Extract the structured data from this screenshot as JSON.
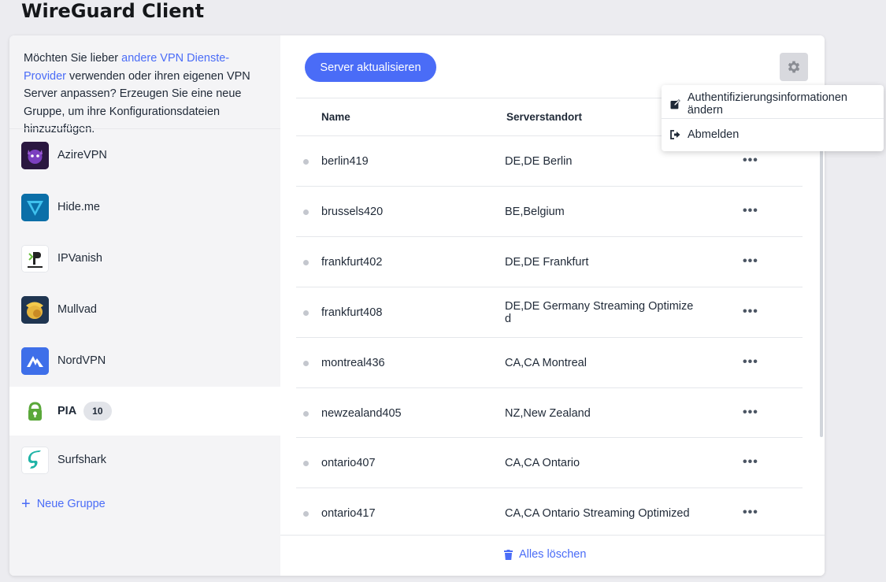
{
  "app": {
    "title": "WireGuard Client"
  },
  "sidebar": {
    "intro_before": "Möchten Sie lieber ",
    "intro_link": "andere VPN Dienste-Provider",
    "intro_after": " verwenden oder ihren eigenen VPN Server anpassen? Erzeugen Sie eine neue Gruppe, um ihre Konfigurationsdateien hinzuzufügen.",
    "providers": [
      {
        "name": "AzireVPN",
        "icon": "azirevpn-logo",
        "active": false
      },
      {
        "name": "Hide.me",
        "icon": "hideme-logo",
        "active": false
      },
      {
        "name": "IPVanish",
        "icon": "ipvanish-logo",
        "active": false
      },
      {
        "name": "Mullvad",
        "icon": "mullvad-logo",
        "active": false
      },
      {
        "name": "NordVPN",
        "icon": "nordvpn-logo",
        "active": false
      },
      {
        "name": "PIA",
        "icon": "pia-logo",
        "active": true,
        "badge": "10"
      },
      {
        "name": "Surfshark",
        "icon": "surfshark-logo",
        "active": false
      }
    ],
    "new_group": "Neue Gruppe"
  },
  "toolbar": {
    "update_label": "Server aktualisieren",
    "settings_icon": "gear-icon"
  },
  "table": {
    "headers": {
      "name": "Name",
      "location": "Serverstandort"
    },
    "rows": [
      {
        "name": "berlin419",
        "location": "DE,DE Berlin"
      },
      {
        "name": "brussels420",
        "location": "BE,Belgium"
      },
      {
        "name": "frankfurt402",
        "location": "DE,DE Frankfurt"
      },
      {
        "name": "frankfurt408",
        "location": "DE,DE Germany Streaming Optimized"
      },
      {
        "name": "montreal436",
        "location": "CA,CA Montreal"
      },
      {
        "name": "newzealand405",
        "location": "NZ,New Zealand"
      },
      {
        "name": "ontario407",
        "location": "CA,CA Ontario"
      },
      {
        "name": "ontario417",
        "location": "CA,CA Ontario Streaming Optimized"
      }
    ],
    "row_menu": "•••",
    "clear_all": "Alles löschen"
  },
  "dropdown": {
    "items": [
      {
        "label": "Authentifizierungsinformationen ändern",
        "icon": "edit-icon"
      },
      {
        "label": "Abmelden",
        "icon": "logout-icon"
      }
    ]
  },
  "colors": {
    "accent": "#4a6cf7",
    "background": "#ececf0",
    "sidebar": "#f4f4f6"
  }
}
